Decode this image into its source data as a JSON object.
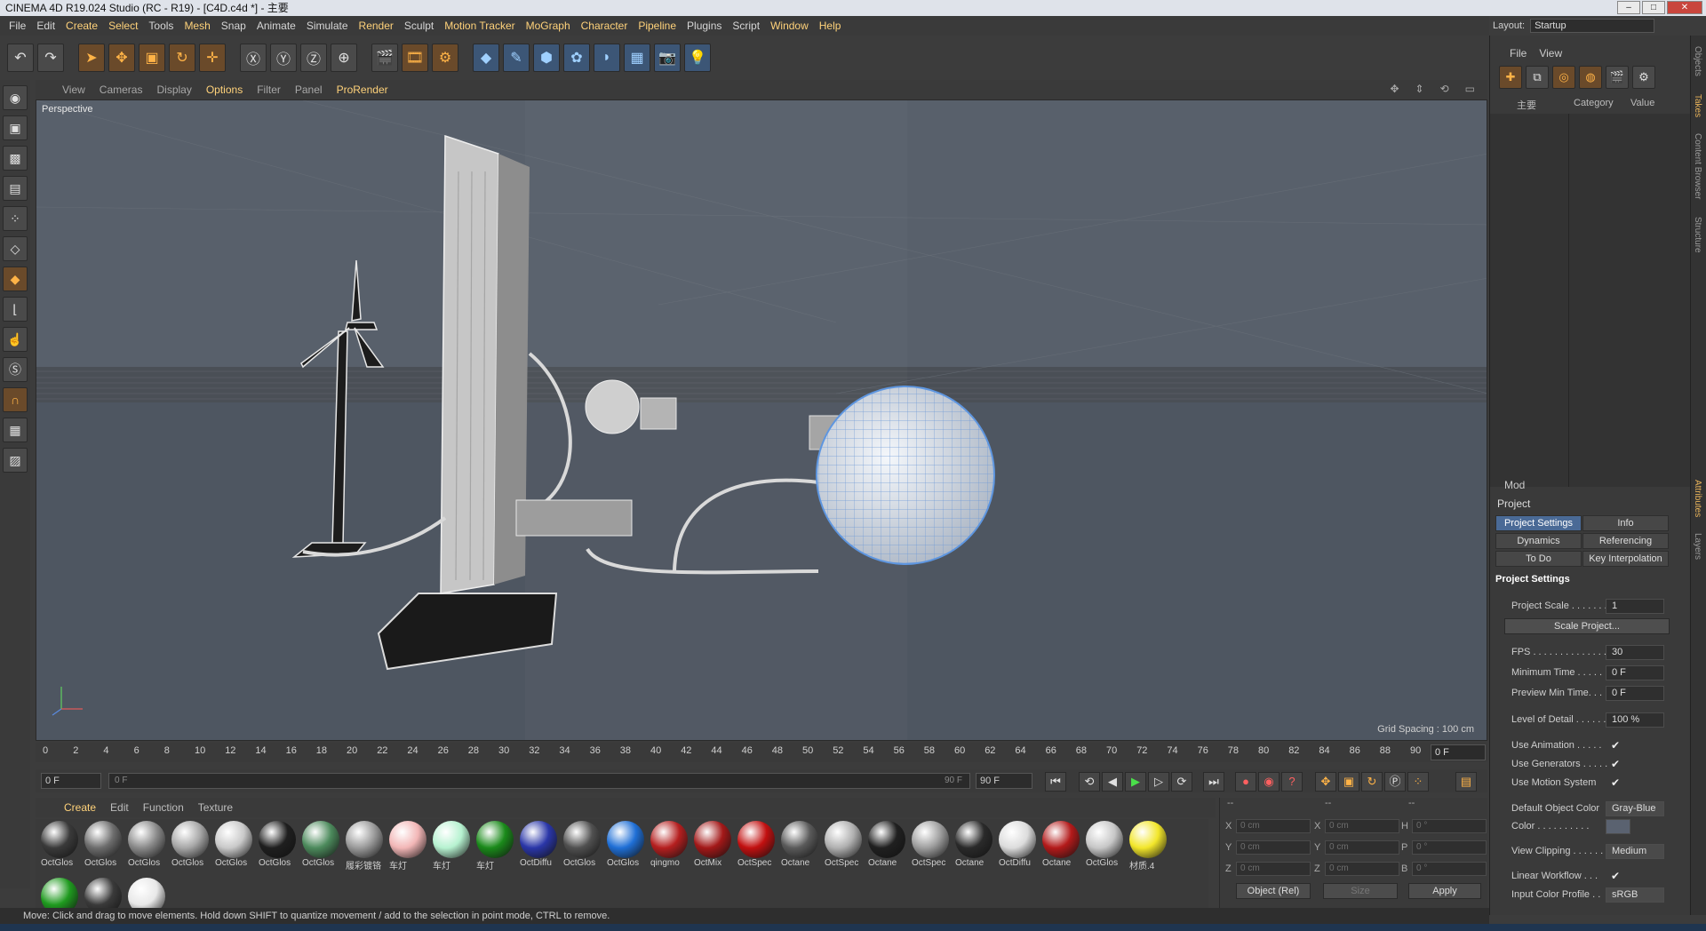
{
  "window": {
    "title": "CINEMA 4D R19.024 Studio (RC - R19) - [C4D.c4d *] - 主要"
  },
  "menu": [
    "File",
    "Edit",
    "Create",
    "Select",
    "Tools",
    "Mesh",
    "Snap",
    "Animate",
    "Simulate",
    "Render",
    "Sculpt",
    "Motion Tracker",
    "MoGraph",
    "Character",
    "Pipeline",
    "Plugins",
    "Script",
    "Window",
    "Help"
  ],
  "layout": {
    "label": "Layout:",
    "value": "Startup"
  },
  "viewport": {
    "menu": [
      "View",
      "Cameras",
      "Display",
      "Options",
      "Filter",
      "Panel",
      "ProRender"
    ],
    "camera_label": "Perspective",
    "grid_spacing": "Grid Spacing : 100 cm"
  },
  "timeline": {
    "ticks": [
      "0",
      "2",
      "4",
      "6",
      "8",
      "10",
      "12",
      "14",
      "16",
      "18",
      "20",
      "22",
      "24",
      "26",
      "28",
      "30",
      "32",
      "34",
      "36",
      "38",
      "40",
      "42",
      "44",
      "46",
      "48",
      "50",
      "52",
      "54",
      "56",
      "58",
      "60",
      "62",
      "64",
      "66",
      "68",
      "70",
      "72",
      "74",
      "76",
      "78",
      "80",
      "82",
      "84",
      "86",
      "88",
      "90"
    ],
    "end_frame": "0 F",
    "start_field": "0 F",
    "slider_start": "0 F",
    "slider_end": "90 F",
    "end_field": "90 F"
  },
  "materials": {
    "menu": [
      "Create",
      "Edit",
      "Function",
      "Texture"
    ],
    "items": [
      {
        "name": "OctGlos",
        "color": "#3a3a3a"
      },
      {
        "name": "OctGlos",
        "color": "#6d6d6d"
      },
      {
        "name": "OctGlos",
        "color": "#8a8a8a"
      },
      {
        "name": "OctGlos",
        "color": "#a7a7a7"
      },
      {
        "name": "OctGlos",
        "color": "#c9c9c9"
      },
      {
        "name": "OctGlos",
        "color": "#1f1f1f"
      },
      {
        "name": "OctGlos",
        "color": "#4c8a5c"
      },
      {
        "name": "履彩镀铬",
        "color": "#9a9a9a"
      },
      {
        "name": "车灯",
        "color": "#f2b6b6"
      },
      {
        "name": "车灯",
        "color": "#b6f2d0"
      },
      {
        "name": "车灯",
        "color": "#1a8a1a"
      },
      {
        "name": "OctDiffu",
        "color": "#2a36a8"
      },
      {
        "name": "OctGlos",
        "color": "#505050"
      },
      {
        "name": "OctGlos",
        "color": "#1f6fd6"
      },
      {
        "name": "qingmo",
        "color": "#b51f1f"
      },
      {
        "name": "OctMix",
        "color": "#a31818"
      },
      {
        "name": "OctSpec",
        "color": "#c21010"
      },
      {
        "name": "Octane",
        "color": "#5a5a5a"
      },
      {
        "name": "OctSpec",
        "color": "#b0b0b0"
      },
      {
        "name": "Octane",
        "color": "#202020"
      },
      {
        "name": "OctSpec",
        "color": "#9e9e9e"
      },
      {
        "name": "Octane",
        "color": "#2a2a2a"
      },
      {
        "name": "OctDiffu",
        "color": "#dcdcdc"
      },
      {
        "name": "Octane",
        "color": "#b31a1a"
      },
      {
        "name": "OctGlos",
        "color": "#c7c7c7"
      },
      {
        "name": "材质.4",
        "color": "#f2e62a"
      }
    ],
    "row2": [
      {
        "name": "",
        "color": "#1f9a1f"
      },
      {
        "name": "",
        "color": "#3a3a3a"
      },
      {
        "name": "",
        "color": "#e8e8e8"
      }
    ]
  },
  "coords": {
    "col_heads": [
      "--",
      "--",
      "--"
    ],
    "rows": [
      {
        "a": "X",
        "av": "0 cm",
        "b": "X",
        "bv": "0 cm",
        "c": "H",
        "cv": "0 °"
      },
      {
        "a": "Y",
        "av": "0 cm",
        "b": "Y",
        "bv": "0 cm",
        "c": "P",
        "cv": "0 °"
      },
      {
        "a": "Z",
        "av": "0 cm",
        "b": "Z",
        "bv": "0 cm",
        "c": "B",
        "cv": "0 °"
      }
    ],
    "mode": "Object (Rel)",
    "size": "Size",
    "apply": "Apply"
  },
  "status": "Move: Click and drag to move elements. Hold down SHIFT to quantize movement / add to the selection in point mode, CTRL to remove.",
  "objects": {
    "menu": [
      "File",
      "View"
    ],
    "columns": [
      "主要",
      "Category",
      "Value"
    ]
  },
  "attributes": {
    "mode": "Mod",
    "title": "Project",
    "tabs": [
      "Project Settings",
      "Info",
      "Dynamics",
      "Referencing",
      "To Do",
      "Key Interpolation"
    ],
    "section": "Project Settings",
    "project_scale_label": "Project Scale . . . . . . .",
    "project_scale": "1",
    "scale_button": "Scale Project...",
    "fps_label": "FPS . . . . . . . . . . . . . . .",
    "fps": "30",
    "min_time_label": "Minimum Time . . . . .",
    "min_time": "0 F",
    "preview_min_label": "Preview Min Time. . .",
    "preview_min": "0 F",
    "lod_label": "Level of Detail . . . . . .",
    "lod": "100 %",
    "use_animation": "Use Animation . . . . .",
    "use_generators": "Use Generators . . . . .",
    "use_motion": "Use Motion System",
    "default_color_label": "Default Object Color",
    "default_color": "Gray-Blue",
    "color_label": "Color . . . . . . . . . .",
    "view_clipping_label": "View Clipping . . . . . .",
    "view_clipping": "Medium",
    "linear_workflow": "Linear Workflow . . .",
    "input_profile_label": "Input Color Profile . .",
    "input_profile": "sRGB"
  },
  "side_tabs": [
    "Objects",
    "Takes",
    "Content Browser",
    "Structure",
    "Attributes",
    "Layers"
  ]
}
